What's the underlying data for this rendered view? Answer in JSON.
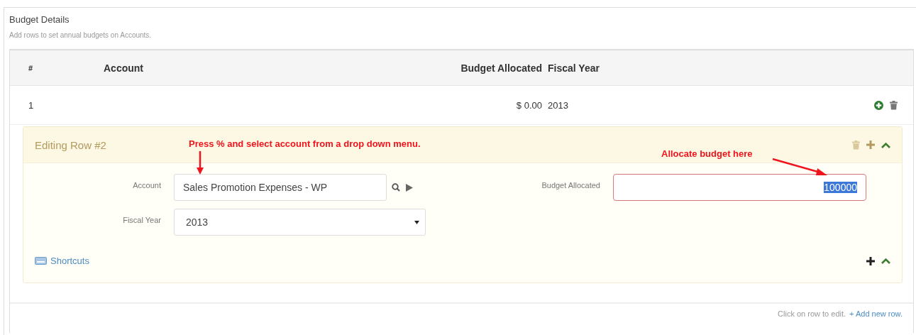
{
  "panel": {
    "title": "Budget Details",
    "subtitle": "Add rows to set annual budgets on Accounts."
  },
  "table": {
    "columns": [
      "#",
      "Account",
      "Budget Allocated",
      "Fiscal Year"
    ],
    "rows": [
      {
        "number": "1",
        "account": "",
        "budget": "$ 0.00",
        "fiscal_year": "2013"
      }
    ]
  },
  "editor": {
    "title": "Editing Row #2",
    "account": {
      "label": "Account",
      "value": "Sales Promotion Expenses - WP"
    },
    "fiscal_year": {
      "label": "Fiscal Year",
      "value": "2013"
    },
    "budget": {
      "label": "Budget Allocated",
      "value": "100000",
      "value_selected": true,
      "invalid": true
    },
    "shortcuts_link": "Shortcuts"
  },
  "footer": {
    "hint": "Click on row to edit.",
    "add_link": "+ Add new row."
  },
  "annotations": [
    {
      "text": "Press % and select account from a drop down menu.",
      "kind": "down"
    },
    {
      "text": "Allocate budget here",
      "kind": "diagonal"
    }
  ]
}
